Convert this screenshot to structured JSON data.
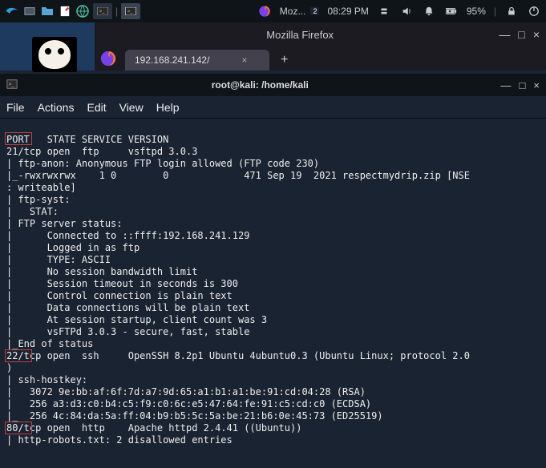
{
  "taskbar": {
    "apps": [
      "kali",
      "files",
      "browser",
      "editor",
      "globe",
      "terminal1",
      "terminal2"
    ],
    "firefox_label": "Moz...",
    "firefox_badge": "2",
    "time": "08:29 PM",
    "battery": "95%"
  },
  "firefox": {
    "title": "Mozilla Firefox",
    "tab_label": "192.168.241.142/",
    "tab_close": "×",
    "newtab": "+",
    "min": "—",
    "max": "□",
    "close": "×"
  },
  "terminal": {
    "title": "root@kali: /home/kali",
    "menus": {
      "file": "File",
      "actions": "Actions",
      "edit": "Edit",
      "view": "View",
      "help": "Help"
    },
    "controls": {
      "min": "—",
      "max": "□",
      "close": "×"
    },
    "lines": [
      "PORT   STATE SERVICE VERSION",
      "21/tcp open  ftp     vsftpd 3.0.3",
      "| ftp-anon: Anonymous FTP login allowed (FTP code 230)",
      "|_-rwxrwxrwx    1 0        0             471 Sep 19  2021 respectmydrip.zip [NSE",
      ": writeable]",
      "| ftp-syst:",
      "|   STAT:",
      "| FTP server status:",
      "|      Connected to ::ffff:192.168.241.129",
      "|      Logged in as ftp",
      "|      TYPE: ASCII",
      "|      No session bandwidth limit",
      "|      Session timeout in seconds is 300",
      "|      Control connection is plain text",
      "|      Data connections will be plain text",
      "|      At session startup, client count was 3",
      "|      vsFTPd 3.0.3 - secure, fast, stable",
      "|_End of status",
      "22/tcp open  ssh     OpenSSH 8.2p1 Ubuntu 4ubuntu0.3 (Ubuntu Linux; protocol 2.0",
      ")",
      "| ssh-hostkey:",
      "|   3072 9e:bb:af:6f:7d:a7:9d:65:a1:b1:a1:be:91:cd:04:28 (RSA)",
      "|   256 a3:d3:c0:b4:c5:f9:c0:6c:e5:47:64:fe:91:c5:cd:c0 (ECDSA)",
      "|_  256 4c:84:da:5a:ff:04:b9:b5:5c:5a:be:21:b6:0e:45:73 (ED25519)",
      "80/tcp open  http    Apache httpd 2.4.41 ((Ubuntu))",
      "| http-robots.txt: 2 disallowed entries"
    ]
  }
}
